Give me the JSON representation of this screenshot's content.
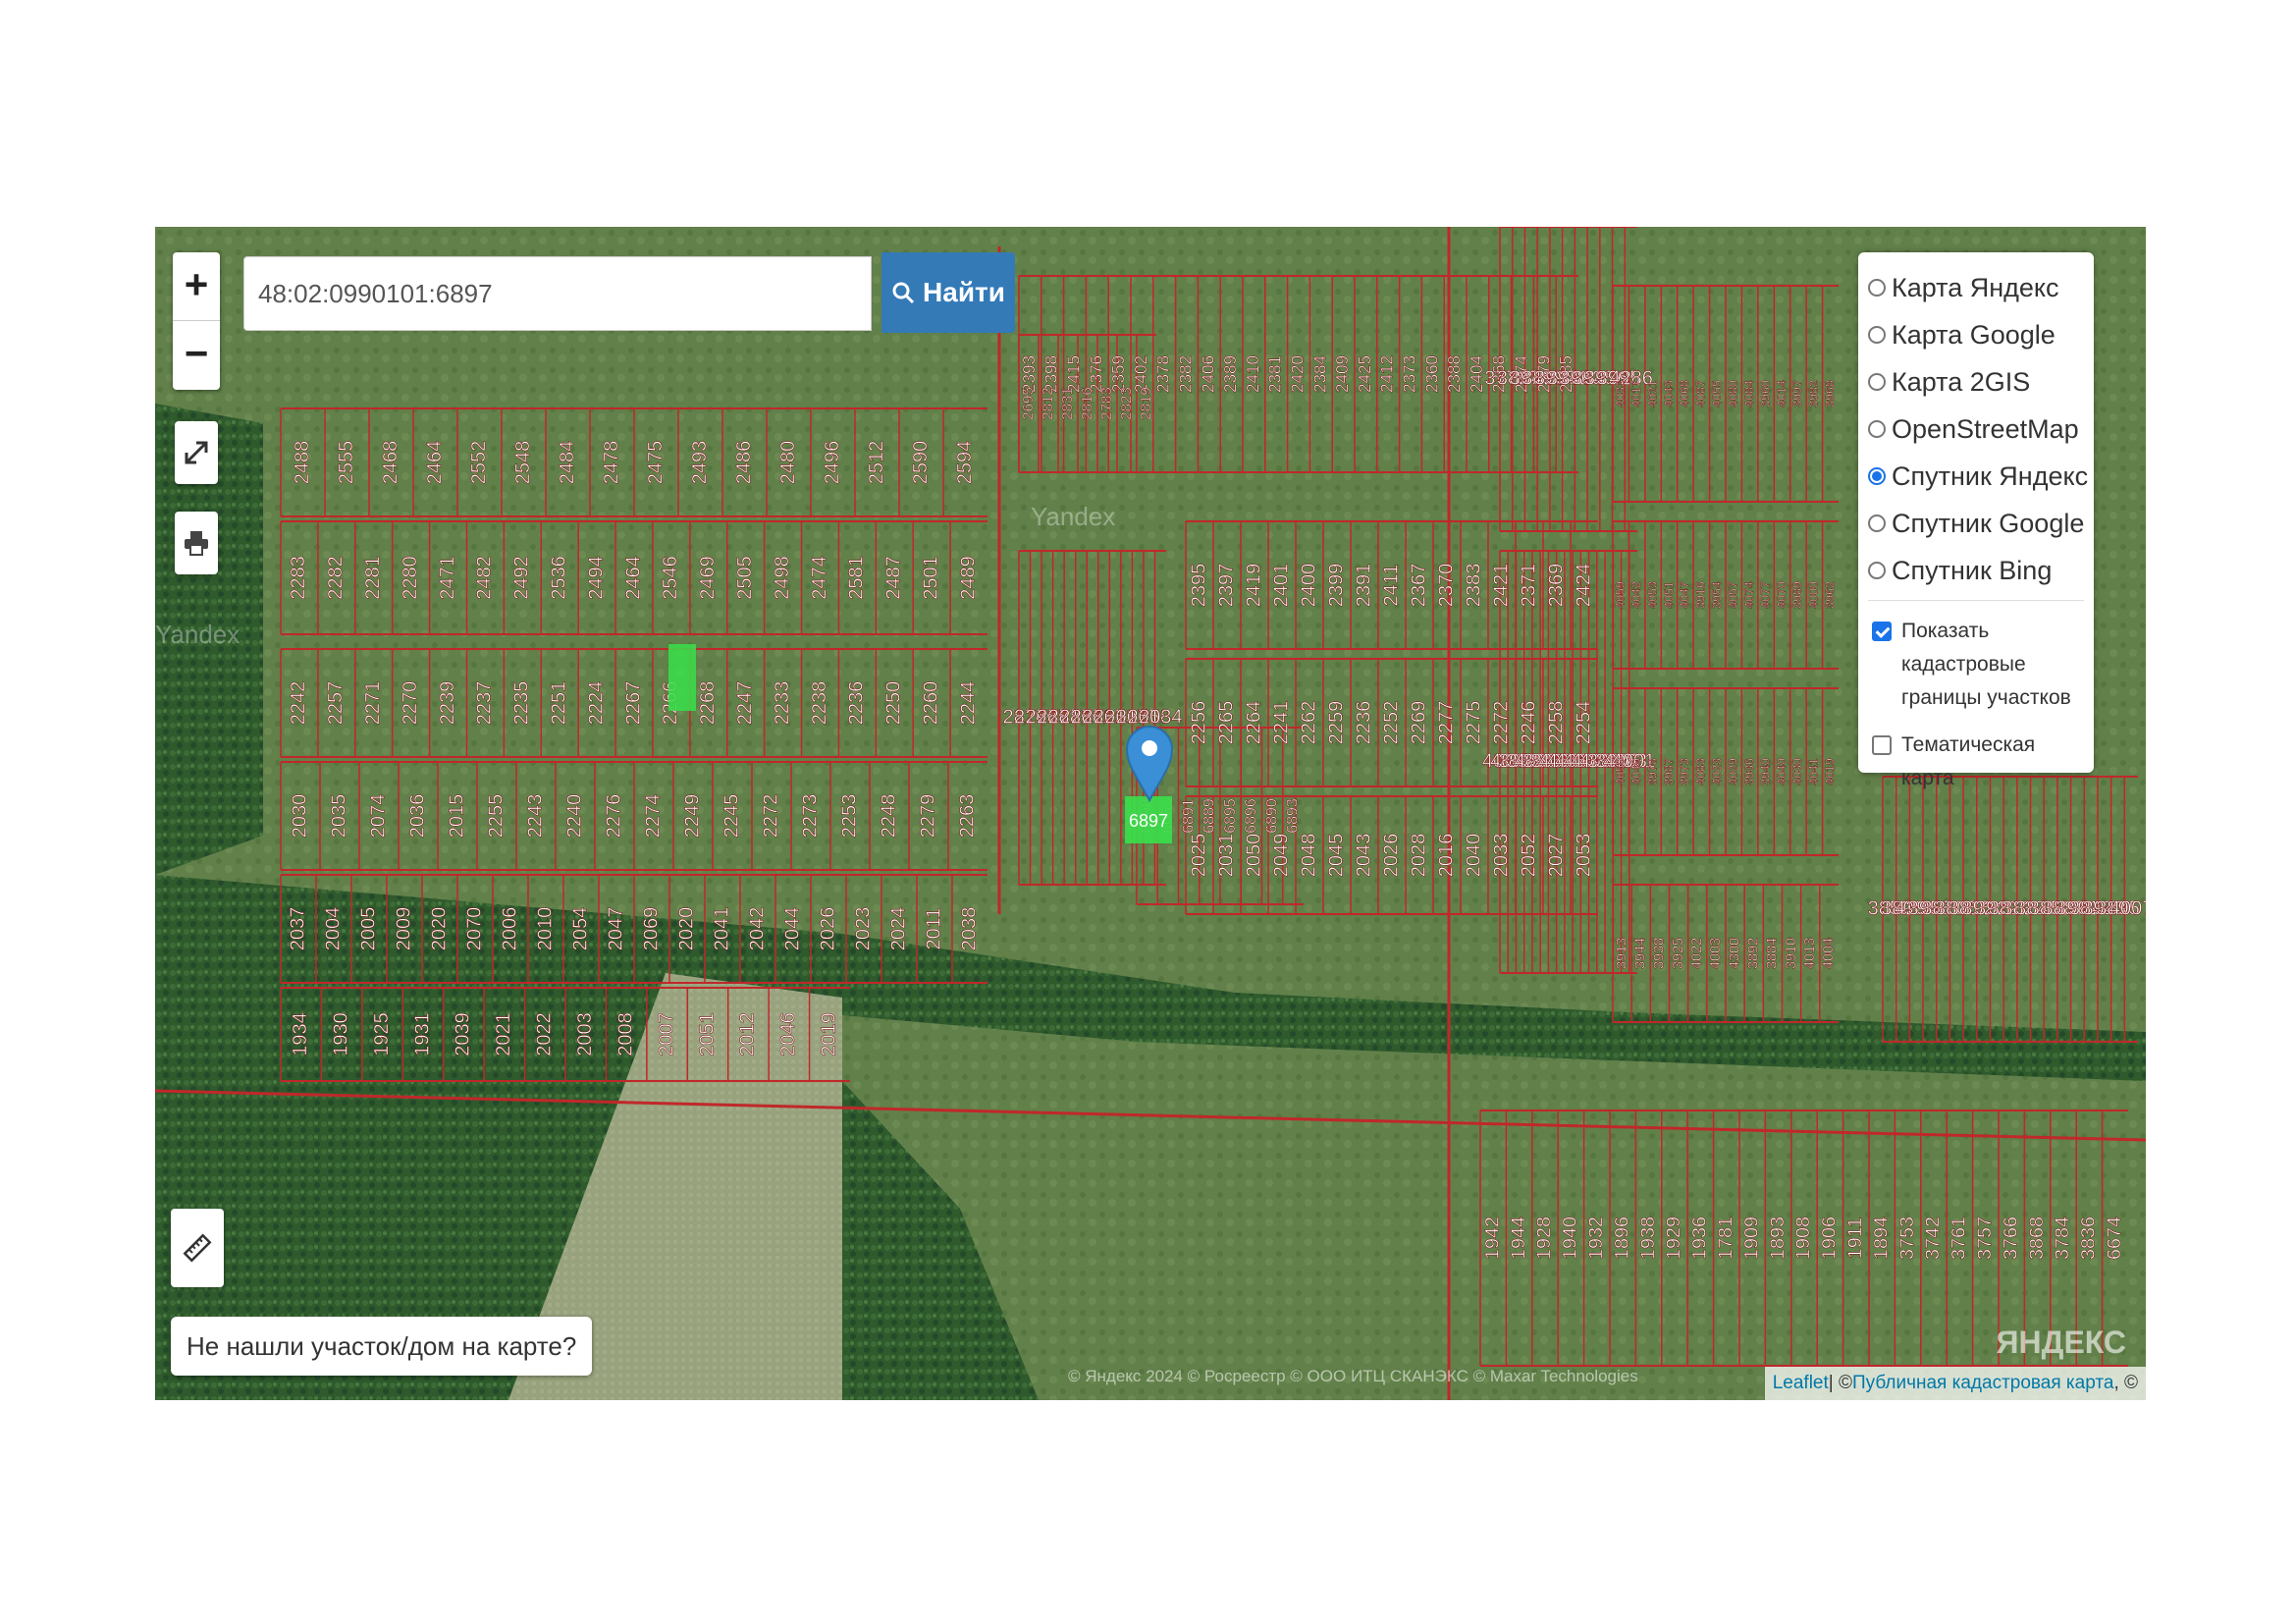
{
  "search": {
    "value": "48:02:0990101:6897",
    "button_label": "Найти"
  },
  "zoom": {
    "in_label": "+",
    "out_label": "−"
  },
  "layers": [
    {
      "label": "Карта Яндекс",
      "selected": false
    },
    {
      "label": "Карта Google",
      "selected": false
    },
    {
      "label": "Карта 2GIS",
      "selected": false
    },
    {
      "label": "OpenStreetMap",
      "selected": false
    },
    {
      "label": "Спутник Яндекс",
      "selected": true
    },
    {
      "label": "Спутник Google",
      "selected": false
    },
    {
      "label": "Спутник Bing",
      "selected": false
    }
  ],
  "overlays": {
    "cadastral": {
      "label": "Показать кадастровые границы участков",
      "checked": true
    },
    "thematic": {
      "label": "Тематическая карта",
      "checked": false
    }
  },
  "not_found_label": "Не нашли участок/дом на карте?",
  "attribution": {
    "leaflet": "Leaflet",
    "separator": " | © ",
    "pkk": "Публичная кадастровая карта",
    "tail": ", ©"
  },
  "yandex_copy": "© Яндекс 2024 © Росреестр © ООО ИТЦ СКАНЭКС © Maxar Technologies",
  "yandex_logo": "ЯНДЕКС",
  "watermarks": {
    "a": "Yandex",
    "b": "Yandex"
  },
  "highlighted_parcel": "6897",
  "parcel_labels": {
    "a": [
      "2488",
      "2555",
      "2468",
      "2464",
      "2552",
      "2548",
      "2484",
      "2478",
      "2475",
      "2493",
      "2486",
      "2480",
      "2496",
      "2512",
      "2590",
      "2594"
    ],
    "b": [
      "2283",
      "2282",
      "2281",
      "2280",
      "2471",
      "2482",
      "2492",
      "2536",
      "2494",
      "2464",
      "2546",
      "2469",
      "2505",
      "2498",
      "2474",
      "2581",
      "2487",
      "2501",
      "2489"
    ],
    "c": [
      "2242",
      "2257",
      "2271",
      "2270",
      "2239",
      "2237",
      "2235",
      "2251",
      "2224",
      "2267",
      "2266",
      "2268",
      "2247",
      "2233",
      "2238",
      "2236",
      "2250",
      "2260",
      "2244"
    ],
    "d": [
      "2030",
      "2035",
      "2074",
      "2036",
      "2015",
      "2255",
      "2243",
      "2240",
      "2276",
      "2274",
      "2249",
      "2245",
      "2272",
      "2273",
      "2253",
      "2248",
      "2279",
      "2263"
    ],
    "e": [
      "2037",
      "2004",
      "2005",
      "2009",
      "2020",
      "2070",
      "2006",
      "2010",
      "2054",
      "2047",
      "2069",
      "2020",
      "2041",
      "2042",
      "2044",
      "2026",
      "2023",
      "2024",
      "2011",
      "2038"
    ],
    "f": [
      "1934",
      "1930",
      "1925",
      "1931",
      "2039",
      "2021",
      "2022",
      "2003",
      "2008",
      "2007",
      "2051",
      "2012",
      "2046",
      "2019"
    ],
    "g": [
      "2393",
      "2398",
      "2415",
      "2376",
      "2359",
      "2402",
      "2378",
      "2382",
      "2406",
      "2389",
      "2410",
      "2381",
      "2420",
      "2384",
      "2409",
      "2425",
      "2412",
      "2373",
      "2360",
      "2388",
      "2404",
      "2368",
      "2374",
      "2379",
      "2385"
    ],
    "h": [
      "2395",
      "2397",
      "2419",
      "2401",
      "2400",
      "2399",
      "2391",
      "2411",
      "2367",
      "2370",
      "2383",
      "2421",
      "2371",
      "2369",
      "2424"
    ],
    "i": [
      "2256",
      "2265",
      "2264",
      "2241",
      "2262",
      "2259",
      "2236",
      "2252",
      "2269",
      "2277",
      "2275",
      "2272",
      "2246",
      "2258",
      "2254"
    ],
    "j": [
      "2025",
      "2031",
      "2050",
      "2049",
      "2048",
      "2045",
      "2043",
      "2026",
      "2028",
      "2016",
      "2040",
      "2033",
      "2052",
      "2027",
      "2053"
    ],
    "k": [
      "2826",
      "2790",
      "2789",
      "2781",
      "2786",
      "2780",
      "2782",
      "2785",
      "2013",
      "2017",
      "2055",
      "2018",
      "2034"
    ],
    "l": [
      "6898",
      "6063",
      "6891",
      "6889",
      "6895",
      "6896",
      "6890",
      "6893"
    ],
    "m": [
      "3778",
      "3827",
      "3949",
      "3829",
      "3937",
      "3942",
      "3963",
      "3945",
      "3976",
      "3995",
      "4286"
    ],
    "n": [
      "4033",
      "4017",
      "4021",
      "4043",
      "4068",
      "4087",
      "4055",
      "4080",
      "4084",
      "3960",
      "4014",
      "3997",
      "3982",
      "3968"
    ],
    "o": [
      "4059",
      "4042",
      "4053",
      "4051",
      "4047",
      "3916",
      "3954",
      "4057",
      "4074",
      "4077",
      "4070",
      "3989",
      "4000",
      "3962"
    ],
    "p": [
      "4060",
      "4045",
      "3969",
      "3993",
      "4005",
      "3977",
      "3964",
      "4066",
      "4072",
      "4054",
      "4058",
      "4073",
      "4082",
      "3980",
      "3985",
      "4063",
      "4001"
    ],
    "q": [
      "4050",
      "4049",
      "3978",
      "3987",
      "3973",
      "4083",
      "4023",
      "4029",
      "3936",
      "3940",
      "4040",
      "4030",
      "4041",
      "4019"
    ],
    "r": [
      "3913",
      "3944",
      "3938",
      "3925",
      "4022",
      "4003",
      "4300",
      "3892",
      "3884",
      "3910",
      "4013",
      "4004"
    ],
    "s": [
      "3859",
      "3800",
      "4294",
      "3958",
      "3870",
      "3805",
      "3815",
      "3924",
      "3922",
      "3813",
      "3820",
      "3845",
      "3852",
      "3887",
      "3901",
      "3843",
      "3943",
      "3895",
      "4007"
    ],
    "t": [
      "2695",
      "2812",
      "2831",
      "2816",
      "2783",
      "2823",
      "2819"
    ],
    "u": [
      "1942",
      "1944",
      "1928",
      "1940",
      "1932",
      "1896",
      "1938",
      "1929",
      "1936",
      "1781",
      "1909",
      "1893",
      "1908",
      "1906",
      "1911",
      "1894",
      "3753",
      "3742",
      "3761",
      "3757",
      "3766",
      "3868",
      "3784",
      "3836",
      "6674"
    ]
  }
}
